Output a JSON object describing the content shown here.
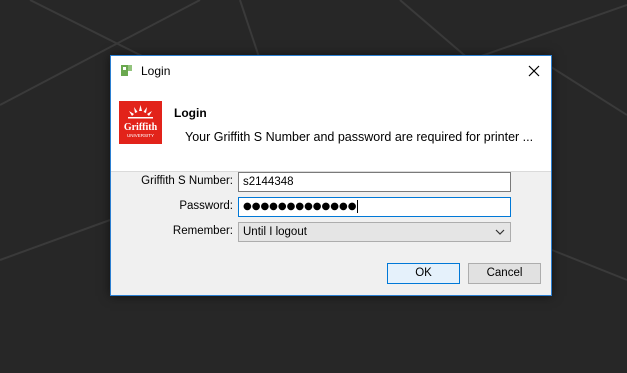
{
  "window": {
    "title": "Login"
  },
  "header": {
    "title": "Login",
    "description": "Your Griffith S Number and password are required for printer ...",
    "logo_alt": "Griffith University"
  },
  "form": {
    "username_label": "Griffith S Number:",
    "username_value": "s2144348",
    "password_label": "Password:",
    "password_masked": "●●●●●●●●●●●●●",
    "remember_label": "Remember:",
    "remember_selected": "Until I logout"
  },
  "buttons": {
    "ok_label": "OK",
    "cancel_label": "Cancel"
  },
  "icons": {
    "app": "papercut-icon",
    "close": "close-icon",
    "dropdown": "chevron-down-icon",
    "logo": "griffith-logo"
  },
  "colors": {
    "desktop_bg": "#272727",
    "dialog_border": "#2b7fd1",
    "focus_border": "#0078d7",
    "logo_red": "#e2231a",
    "app_icon_green": "#6aa84f"
  }
}
